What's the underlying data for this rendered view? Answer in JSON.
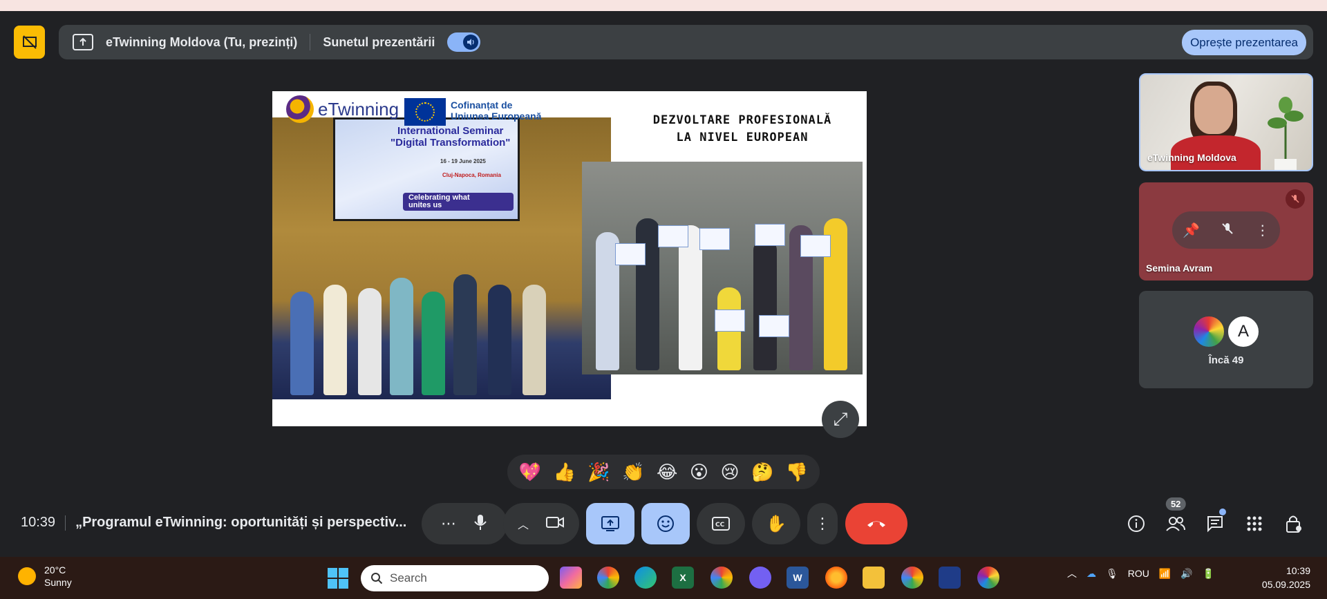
{
  "present_bar": {
    "title": "eTwinning Moldova (Tu, prezinți)",
    "sound_label": "Sunetul prezentării",
    "stop_label": "Oprește prezentarea"
  },
  "slide": {
    "logo_text": "eTwinning",
    "eu_line1": "Cofinanțat de",
    "eu_line2": "Uniunea Europeană",
    "heading_line1": "DEZVOLTARE PROFESIONALĂ",
    "heading_line2": "LA NIVEL EUROPEAN",
    "screen_title_line1": "International Seminar",
    "screen_title_line2": "\"Digital Transformation\"",
    "screen_date": "16 - 19 June 2025",
    "screen_place": "Cluj-Napoca, Romania",
    "screen_pill_line1": "Celebrating what",
    "screen_pill_line2": "unites us"
  },
  "participants": {
    "tile1_name": "eTwinning Moldova",
    "tile2_name": "Semina Avram",
    "avatar_letter": "A",
    "more_label": "Încă 49"
  },
  "reactions": [
    "💖",
    "👍",
    "🎉",
    "👏",
    "😂",
    "😮",
    "😢",
    "🤔",
    "👎"
  ],
  "bottom": {
    "clock": "10:39",
    "meeting_title": "„Programul eTwinning: oportunități și perspectiv..."
  },
  "people_count": "52",
  "taskbar": {
    "temperature": "20°C",
    "condition": "Sunny",
    "search_placeholder": "Search",
    "language": "ROU",
    "time": "10:39",
    "date": "05.09.2025"
  },
  "colors": {
    "accent": "#a8c7fa",
    "end_call": "#ea4335",
    "badge": "#fbbc04"
  }
}
